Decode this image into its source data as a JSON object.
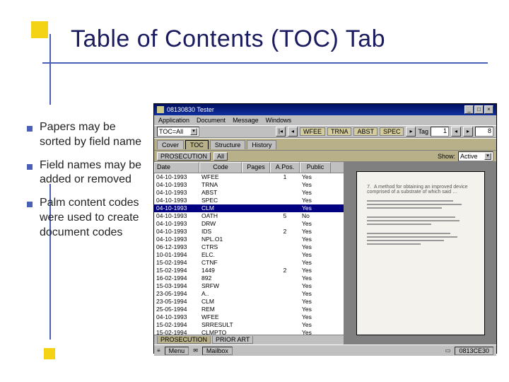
{
  "slide": {
    "title": "Table of Contents (TOC) Tab",
    "bullets": [
      "Papers may be sorted by field name",
      "Field names may be added or removed",
      "Palm content codes were used to create document codes"
    ]
  },
  "app": {
    "window_title": "08130830   Tester",
    "win_buttons": {
      "min": "_",
      "max": "□",
      "close": "×"
    },
    "menus": [
      "Application",
      "Document",
      "Message",
      "Windows"
    ],
    "toc_dropdown": "TOC=All",
    "right_bar": {
      "codes": [
        "WFEE",
        "TRNA",
        "ABST",
        "SPEC"
      ],
      "tag_label": "Tag",
      "tag_value": "1",
      "nav_total": "8"
    },
    "tabs_upper": [
      "Cover",
      "TOC",
      "Structure",
      "History"
    ],
    "tabs_upper_active": "TOC",
    "filter": {
      "label": "PROSECUTION",
      "value": "All",
      "show_label": "Show:",
      "show_value": "Active"
    },
    "columns": [
      "Date",
      "Code",
      "Pages",
      "A.Pos.",
      "Public"
    ],
    "rows": [
      {
        "date": "04-10-1993",
        "code": "WFEE",
        "pages": "",
        "apos": "1",
        "pub": "Yes",
        "sel": false
      },
      {
        "date": "04-10-1993",
        "code": "TRNA",
        "pages": "",
        "apos": "",
        "pub": "Yes",
        "sel": false
      },
      {
        "date": "04-10-1993",
        "code": "ABST",
        "pages": "",
        "apos": "",
        "pub": "Yes",
        "sel": false
      },
      {
        "date": "04-10-1993",
        "code": "SPEC",
        "pages": "",
        "apos": "",
        "pub": "Yes",
        "sel": false
      },
      {
        "date": "04-10-1993",
        "code": "CLM",
        "pages": "",
        "apos": "",
        "pub": "Yes",
        "sel": true
      },
      {
        "date": "04-10-1993",
        "code": "OATH",
        "pages": "",
        "apos": "5",
        "pub": "No",
        "sel": false
      },
      {
        "date": "04-10-1993",
        "code": "DRW",
        "pages": "",
        "apos": "",
        "pub": "Yes",
        "sel": false
      },
      {
        "date": "04-10-1993",
        "code": "IDS",
        "pages": "",
        "apos": "2",
        "pub": "Yes",
        "sel": false
      },
      {
        "date": "04-10-1993",
        "code": "NPL.O1",
        "pages": "",
        "apos": "",
        "pub": "Yes",
        "sel": false
      },
      {
        "date": "06-12-1993",
        "code": "CTRS",
        "pages": "",
        "apos": "",
        "pub": "Yes",
        "sel": false
      },
      {
        "date": "10-01-1994",
        "code": "ELC.",
        "pages": "",
        "apos": "",
        "pub": "Yes",
        "sel": false
      },
      {
        "date": "15-02-1994",
        "code": "CTNF",
        "pages": "",
        "apos": "",
        "pub": "Yes",
        "sel": false
      },
      {
        "date": "15-02-1994",
        "code": "1449",
        "pages": "",
        "apos": "2",
        "pub": "Yes",
        "sel": false
      },
      {
        "date": "16-02-1994",
        "code": "892",
        "pages": "",
        "apos": "",
        "pub": "Yes",
        "sel": false
      },
      {
        "date": "15-03-1994",
        "code": "SRFW",
        "pages": "",
        "apos": "",
        "pub": "Yes",
        "sel": false
      },
      {
        "date": "23-05-1994",
        "code": "A..",
        "pages": "",
        "apos": "",
        "pub": "Yes",
        "sel": false
      },
      {
        "date": "23-05-1994",
        "code": "CLM",
        "pages": "",
        "apos": "",
        "pub": "Yes",
        "sel": false
      },
      {
        "date": "25-05-1994",
        "code": "REM",
        "pages": "",
        "apos": "",
        "pub": "Yes",
        "sel": false
      },
      {
        "date": "04-10-1993",
        "code": "WFEE",
        "pages": "",
        "apos": "",
        "pub": "Yes",
        "sel": false
      },
      {
        "date": "15-02-1994",
        "code": "SRRESULT",
        "pages": "",
        "apos": "",
        "pub": "Yes",
        "sel": false
      },
      {
        "date": "15-02-1994",
        "code": "CLMPTO",
        "pages": "",
        "apos": "",
        "pub": "Yes",
        "sel": false
      }
    ],
    "tabs_lower": [
      "PROSECUTION",
      "PRIOR ART"
    ],
    "tabs_lower_active": "PROSECUTION",
    "statusbar": {
      "menu": "Menu",
      "mailbox": "Mailbox",
      "case": "0813CE30"
    }
  }
}
